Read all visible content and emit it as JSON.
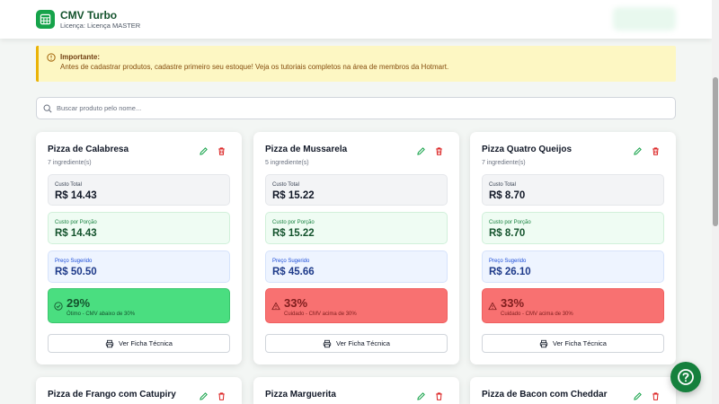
{
  "header": {
    "title": "CMV Turbo",
    "subtitle": "Licença: Licença MASTER",
    "logo_icon": "table-icon"
  },
  "alert": {
    "title": "Importante:",
    "text": "Antes de cadastrar produtos, cadastre primeiro seu estoque! Veja os tutoriais completos na área de membros da Hotmart."
  },
  "search": {
    "placeholder": "Buscar produto pelo nome..."
  },
  "labels": {
    "custo_total": "Custo Total",
    "custo_porcao": "Custo por Porção",
    "preco_sugerido": "Preço Sugerido",
    "ver_ficha": "Ver Ficha Técnica"
  },
  "products": [
    {
      "name": "Pizza de Calabresa",
      "ingredients": "7 ingrediente(s)",
      "custo_total": "R$ 14.43",
      "custo_porcao": "R$ 14.43",
      "preco_sugerido": "R$ 50.50",
      "cmv": "29%",
      "cmv_status": "good",
      "cmv_note": "Ótimo - CMV abaixo de 30%"
    },
    {
      "name": "Pizza de Mussarela",
      "ingredients": "5 ingrediente(s)",
      "custo_total": "R$ 15.22",
      "custo_porcao": "R$ 15.22",
      "preco_sugerido": "R$ 45.66",
      "cmv": "33%",
      "cmv_status": "bad",
      "cmv_note": "Cuidado - CMV acima de 30%"
    },
    {
      "name": "Pizza Quatro Queijos",
      "ingredients": "7 ingrediente(s)",
      "custo_total": "R$ 8.70",
      "custo_porcao": "R$ 8.70",
      "preco_sugerido": "R$ 26.10",
      "cmv": "33%",
      "cmv_status": "bad",
      "cmv_note": "Cuidado - CMV acima de 30%"
    },
    {
      "name": "Pizza de Frango com Catupiry"
    },
    {
      "name": "Pizza Marguerita"
    },
    {
      "name": "Pizza de Bacon com Cheddar"
    }
  ],
  "colors": {
    "brand": "#16a34a",
    "good": "#4ade80",
    "bad": "#f87171",
    "alert_bg": "#fdf7c3"
  }
}
